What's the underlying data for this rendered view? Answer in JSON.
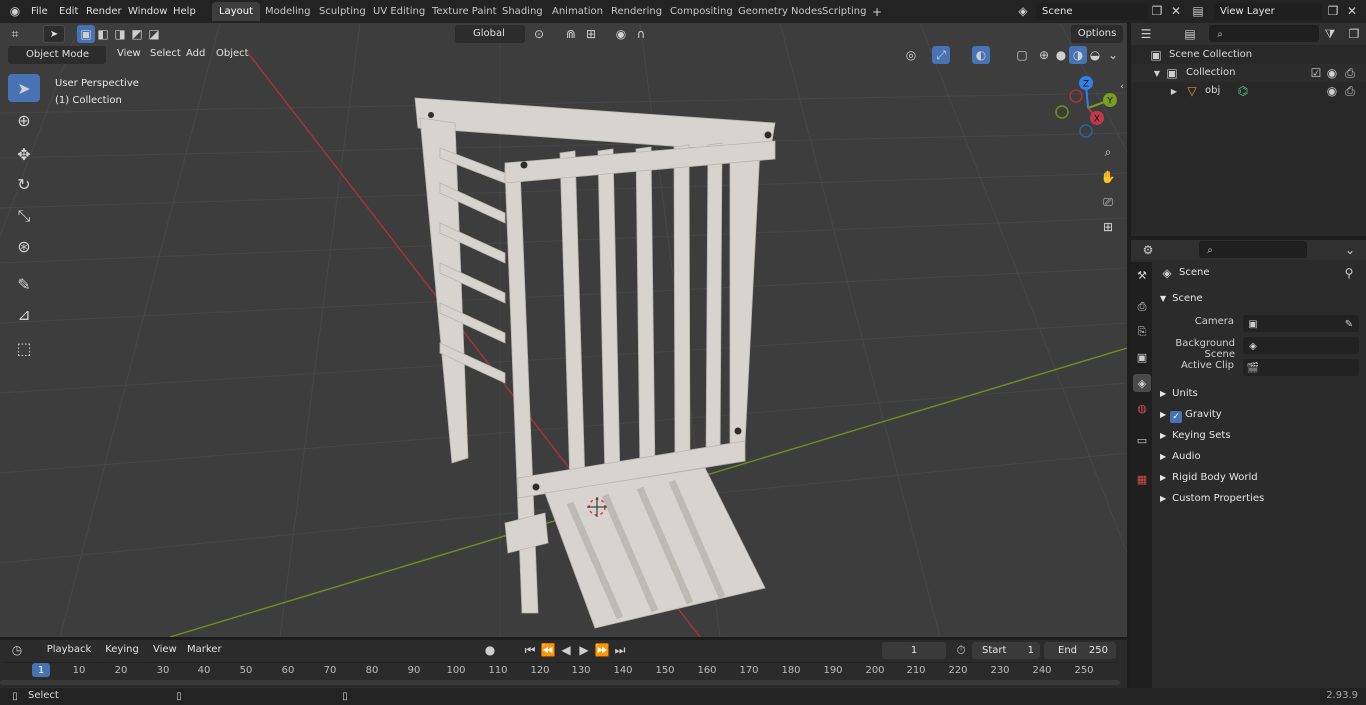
{
  "menus": [
    "File",
    "Edit",
    "Render",
    "Window",
    "Help"
  ],
  "workspace_tabs": [
    "Layout",
    "Modeling",
    "Sculpting",
    "UV Editing",
    "Texture Paint",
    "Shading",
    "Animation",
    "Rendering",
    "Compositing",
    "Geometry Nodes",
    "Scripting"
  ],
  "scene_field": "Scene",
  "view_layer_field": "View Layer",
  "viewport": {
    "mode": "Object Mode",
    "menus": [
      "View",
      "Select",
      "Add",
      "Object"
    ],
    "orientation": "Global",
    "options_label": "Options",
    "perspective_label": "User Perspective",
    "collection_label": "(1) Collection",
    "gizmo_axes": {
      "z": "Z",
      "y": "Y",
      "x": "X"
    }
  },
  "outliner": {
    "root": "Scene Collection",
    "collection": "Collection",
    "object": "obj"
  },
  "properties": {
    "title": "Scene",
    "section": "Scene",
    "fields": [
      {
        "label": "Camera",
        "value": ""
      },
      {
        "label": "Background Scene",
        "value": ""
      },
      {
        "label": "Active Clip",
        "value": ""
      }
    ],
    "panels": [
      "Units",
      "Gravity",
      "Keying Sets",
      "Audio",
      "Rigid Body World",
      "Custom Properties"
    ]
  },
  "timeline": {
    "menus": [
      "Playback",
      "Keying",
      "View",
      "Marker"
    ],
    "current_frame": "1",
    "start_label": "Start",
    "start_value": "1",
    "end_label": "End",
    "end_value": "250",
    "ticks": [
      "1",
      "10",
      "20",
      "30",
      "40",
      "50",
      "60",
      "70",
      "80",
      "90",
      "100",
      "110",
      "120",
      "130",
      "140",
      "150",
      "160",
      "170",
      "180",
      "190",
      "200",
      "210",
      "220",
      "230",
      "240",
      "250"
    ]
  },
  "status": {
    "left": "Select",
    "version": "2.93.9"
  },
  "colors": {
    "accent": "#4772b3",
    "x_axis": "#c0394b",
    "y_axis": "#7a9e1f",
    "z_axis": "#2f82e6"
  }
}
